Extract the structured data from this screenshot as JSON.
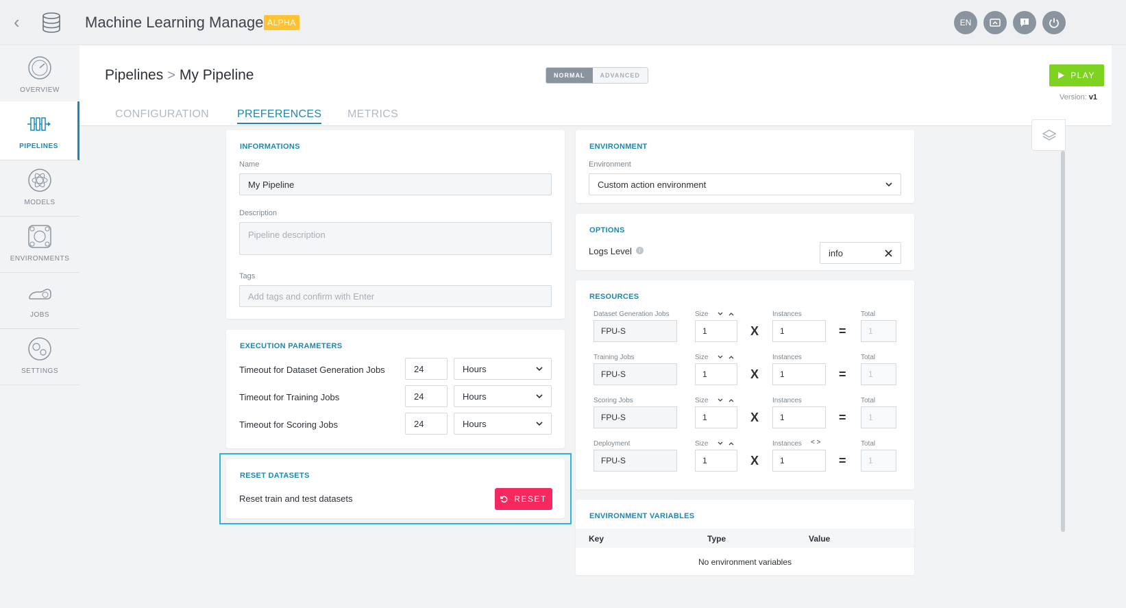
{
  "app": {
    "title": "Machine Learning Manager",
    "badge": "ALPHA",
    "lang": "EN"
  },
  "sidebar": {
    "items": [
      {
        "label": "OVERVIEW",
        "icon": "gauge-icon"
      },
      {
        "label": "PIPELINES",
        "icon": "pipeline-icon"
      },
      {
        "label": "MODELS",
        "icon": "atom-icon"
      },
      {
        "label": "ENVIRONMENTS",
        "icon": "environment-icon"
      },
      {
        "label": "JOBS",
        "icon": "jobs-icon"
      },
      {
        "label": "SETTINGS",
        "icon": "gears-icon"
      }
    ],
    "active": "PIPELINES"
  },
  "header": {
    "breadcrumb_root": "Pipelines",
    "breadcrumb_sep": ">",
    "breadcrumb_current": "My Pipeline",
    "mode_normal": "NORMAL",
    "mode_advanced": "ADVANCED",
    "play_label": "PLAY",
    "version_label": "Version:",
    "version_value": "v1",
    "tabs": [
      "CONFIGURATION",
      "PREFERENCES",
      "METRICS"
    ],
    "active_tab": "PREFERENCES"
  },
  "informations": {
    "title": "INFORMATIONS",
    "name_label": "Name",
    "name_value": "My Pipeline",
    "description_label": "Description",
    "description_placeholder": "Pipeline description",
    "tags_label": "Tags",
    "tags_placeholder": "Add tags and confirm with Enter"
  },
  "execution": {
    "title": "EXECUTION PARAMETERS",
    "rows": [
      {
        "label": "Timeout for Dataset Generation Jobs",
        "value": "24",
        "unit": "Hours"
      },
      {
        "label": "Timeout for Training Jobs",
        "value": "24",
        "unit": "Hours"
      },
      {
        "label": "Timeout for Scoring Jobs",
        "value": "24",
        "unit": "Hours"
      }
    ]
  },
  "reset": {
    "title": "RESET DATASETS",
    "description": "Reset train and test datasets",
    "button": "RESET"
  },
  "environment": {
    "title": "ENVIRONMENT",
    "label": "Environment",
    "value": "Custom action environment"
  },
  "options": {
    "title": "OPTIONS",
    "logs_label": "Logs Level",
    "logs_value": "info"
  },
  "resources": {
    "title": "RESOURCES",
    "size_label": "Size",
    "instances_label": "Instances",
    "total_label": "Total",
    "x": "X",
    "eq": "=",
    "rows": [
      {
        "label": "Dataset Generation Jobs",
        "type": "FPU-S",
        "size": "1",
        "instances": "1",
        "total": "1"
      },
      {
        "label": "Training Jobs",
        "type": "FPU-S",
        "size": "1",
        "instances": "1",
        "total": "1"
      },
      {
        "label": "Scoring Jobs",
        "type": "FPU-S",
        "size": "1",
        "instances": "1",
        "total": "1"
      },
      {
        "label": "Deployment",
        "type": "FPU-S",
        "size": "1",
        "instances": "1",
        "total": "1"
      }
    ]
  },
  "env_vars": {
    "title": "ENVIRONMENT VARIABLES",
    "col_key": "Key",
    "col_type": "Type",
    "col_value": "Value",
    "empty": "No environment variables"
  }
}
